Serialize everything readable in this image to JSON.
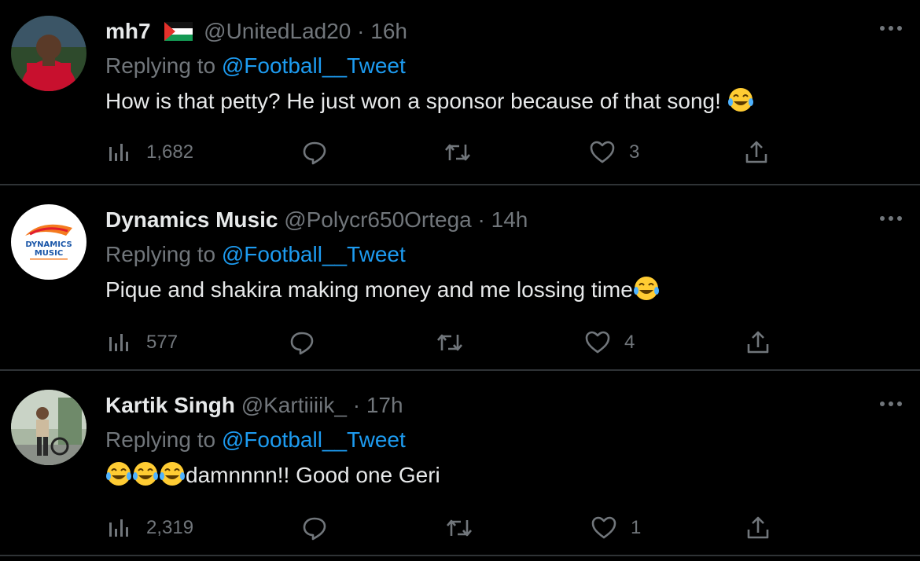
{
  "replying_label": "Replying to ",
  "tweets": [
    {
      "name": "mh7",
      "handle": "@UnitedLad20",
      "time": "· 16h",
      "reply_to": "@Football__Tweet",
      "text": "How is that petty? He just won a sponsor because of that song!",
      "views": "1,682",
      "likes": "3"
    },
    {
      "name": "Dynamics Music",
      "handle": "@Polycr650Ortega",
      "time": "· 14h",
      "reply_to": "@Football__Tweet",
      "text": "Pique and shakira making money and me lossing time",
      "views": "577",
      "likes": "4",
      "avatar_text": "DYNAMICS MUSIC"
    },
    {
      "name": "Kartik Singh",
      "handle": "@Kartiiiik_",
      "time": "· 17h",
      "reply_to": "@Football__Tweet",
      "text": "damnnnn!! Good one Geri",
      "views": "2,319",
      "likes": "1"
    }
  ],
  "icons": {
    "views": "views-chart-icon",
    "reply": "reply-bubble-icon",
    "retweet": "retweet-icon",
    "like": "heart-icon",
    "share": "share-icon",
    "more": "more-dots-icon",
    "emoji": "tears-of-joy-emoji"
  },
  "colors": {
    "background": "#000000",
    "text": "#e7e9ea",
    "muted": "#71767b",
    "link": "#1d9bf0",
    "divider": "#2f3336"
  }
}
